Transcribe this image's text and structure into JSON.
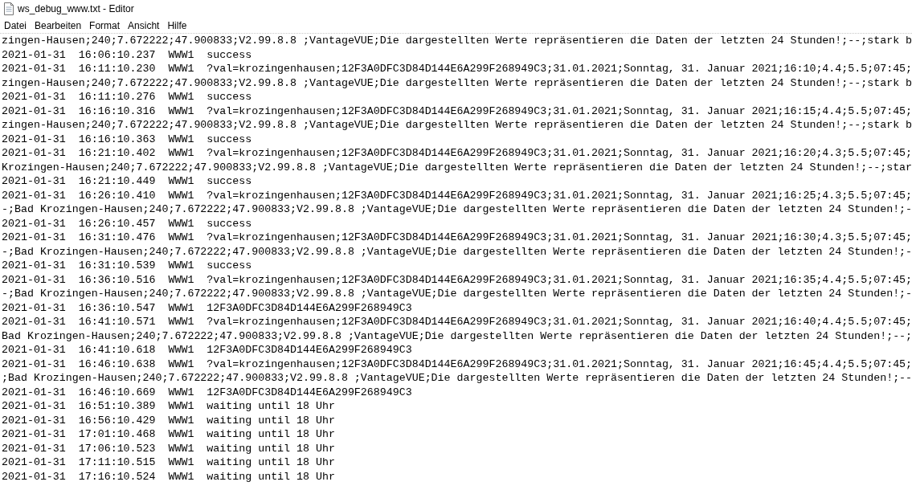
{
  "window": {
    "title": "ws_debug_www.txt - Editor"
  },
  "menu": [
    {
      "label": "Datei"
    },
    {
      "label": "Bearbeiten"
    },
    {
      "label": "Format"
    },
    {
      "label": "Ansicht"
    },
    {
      "label": "Hilfe"
    }
  ],
  "lines": [
    "zingen-Hausen;240;7.672222;47.900833;V2.99.8.8 ;VantageVUE;Die dargestellten Werte repräsentieren die Daten der letzten 24 Stunden!;--;stark b",
    "2021-01-31  16:06:10.237  WWW1  success",
    "2021-01-31  16:11:10.230  WWW1  ?val=krozingenhausen;12F3A0DFC3D84D144E6A299F268949C3;31.01.2021;Sonntag, 31. Januar 2021;16:10;4.4;5.5;07:45;",
    "zingen-Hausen;240;7.672222;47.900833;V2.99.8.8 ;VantageVUE;Die dargestellten Werte repräsentieren die Daten der letzten 24 Stunden!;--;stark b",
    "2021-01-31  16:11:10.276  WWW1  success",
    "2021-01-31  16:16:10.316  WWW1  ?val=krozingenhausen;12F3A0DFC3D84D144E6A299F268949C3;31.01.2021;Sonntag, 31. Januar 2021;16:15;4.4;5.5;07:45;",
    "zingen-Hausen;240;7.672222;47.900833;V2.99.8.8 ;VantageVUE;Die dargestellten Werte repräsentieren die Daten der letzten 24 Stunden!;--;stark b",
    "2021-01-31  16:16:10.363  WWW1  success",
    "2021-01-31  16:21:10.402  WWW1  ?val=krozingenhausen;12F3A0DFC3D84D144E6A299F268949C3;31.01.2021;Sonntag, 31. Januar 2021;16:20;4.3;5.5;07:45;",
    "Krozingen-Hausen;240;7.672222;47.900833;V2.99.8.8 ;VantageVUE;Die dargestellten Werte repräsentieren die Daten der letzten 24 Stunden!;--;star",
    "2021-01-31  16:21:10.449  WWW1  success",
    "2021-01-31  16:26:10.410  WWW1  ?val=krozingenhausen;12F3A0DFC3D84D144E6A299F268949C3;31.01.2021;Sonntag, 31. Januar 2021;16:25;4.3;5.5;07:45;",
    "-;Bad Krozingen-Hausen;240;7.672222;47.900833;V2.99.8.8 ;VantageVUE;Die dargestellten Werte repräsentieren die Daten der letzten 24 Stunden!;-",
    "2021-01-31  16:26:10.457  WWW1  success",
    "2021-01-31  16:31:10.476  WWW1  ?val=krozingenhausen;12F3A0DFC3D84D144E6A299F268949C3;31.01.2021;Sonntag, 31. Januar 2021;16:30;4.3;5.5;07:45;",
    "-;Bad Krozingen-Hausen;240;7.672222;47.900833;V2.99.8.8 ;VantageVUE;Die dargestellten Werte repräsentieren die Daten der letzten 24 Stunden!;-",
    "2021-01-31  16:31:10.539  WWW1  success",
    "2021-01-31  16:36:10.516  WWW1  ?val=krozingenhausen;12F3A0DFC3D84D144E6A299F268949C3;31.01.2021;Sonntag, 31. Januar 2021;16:35;4.4;5.5;07:45;",
    "-;Bad Krozingen-Hausen;240;7.672222;47.900833;V2.99.8.8 ;VantageVUE;Die dargestellten Werte repräsentieren die Daten der letzten 24 Stunden!;-",
    "2021-01-31  16:36:10.547  WWW1  12F3A0DFC3D84D144E6A299F268949C3",
    "2021-01-31  16:41:10.571  WWW1  ?val=krozingenhausen;12F3A0DFC3D84D144E6A299F268949C3;31.01.2021;Sonntag, 31. Januar 2021;16:40;4.4;5.5;07:45;",
    "Bad Krozingen-Hausen;240;7.672222;47.900833;V2.99.8.8 ;VantageVUE;Die dargestellten Werte repräsentieren die Daten der letzten 24 Stunden!;--;",
    "2021-01-31  16:41:10.618  WWW1  12F3A0DFC3D84D144E6A299F268949C3",
    "2021-01-31  16:46:10.638  WWW1  ?val=krozingenhausen;12F3A0DFC3D84D144E6A299F268949C3;31.01.2021;Sonntag, 31. Januar 2021;16:45;4.4;5.5;07:45;",
    ";Bad Krozingen-Hausen;240;7.672222;47.900833;V2.99.8.8 ;VantageVUE;Die dargestellten Werte repräsentieren die Daten der letzten 24 Stunden!;--",
    "2021-01-31  16:46:10.669  WWW1  12F3A0DFC3D84D144E6A299F268949C3",
    "2021-01-31  16:51:10.389  WWW1  waiting until 18 Uhr",
    "2021-01-31  16:56:10.429  WWW1  waiting until 18 Uhr",
    "2021-01-31  17:01:10.468  WWW1  waiting until 18 Uhr",
    "2021-01-31  17:06:10.523  WWW1  waiting until 18 Uhr",
    "2021-01-31  17:11:10.515  WWW1  waiting until 18 Uhr",
    "2021-01-31  17:16:10.524  WWW1  waiting until 18 Uhr"
  ]
}
